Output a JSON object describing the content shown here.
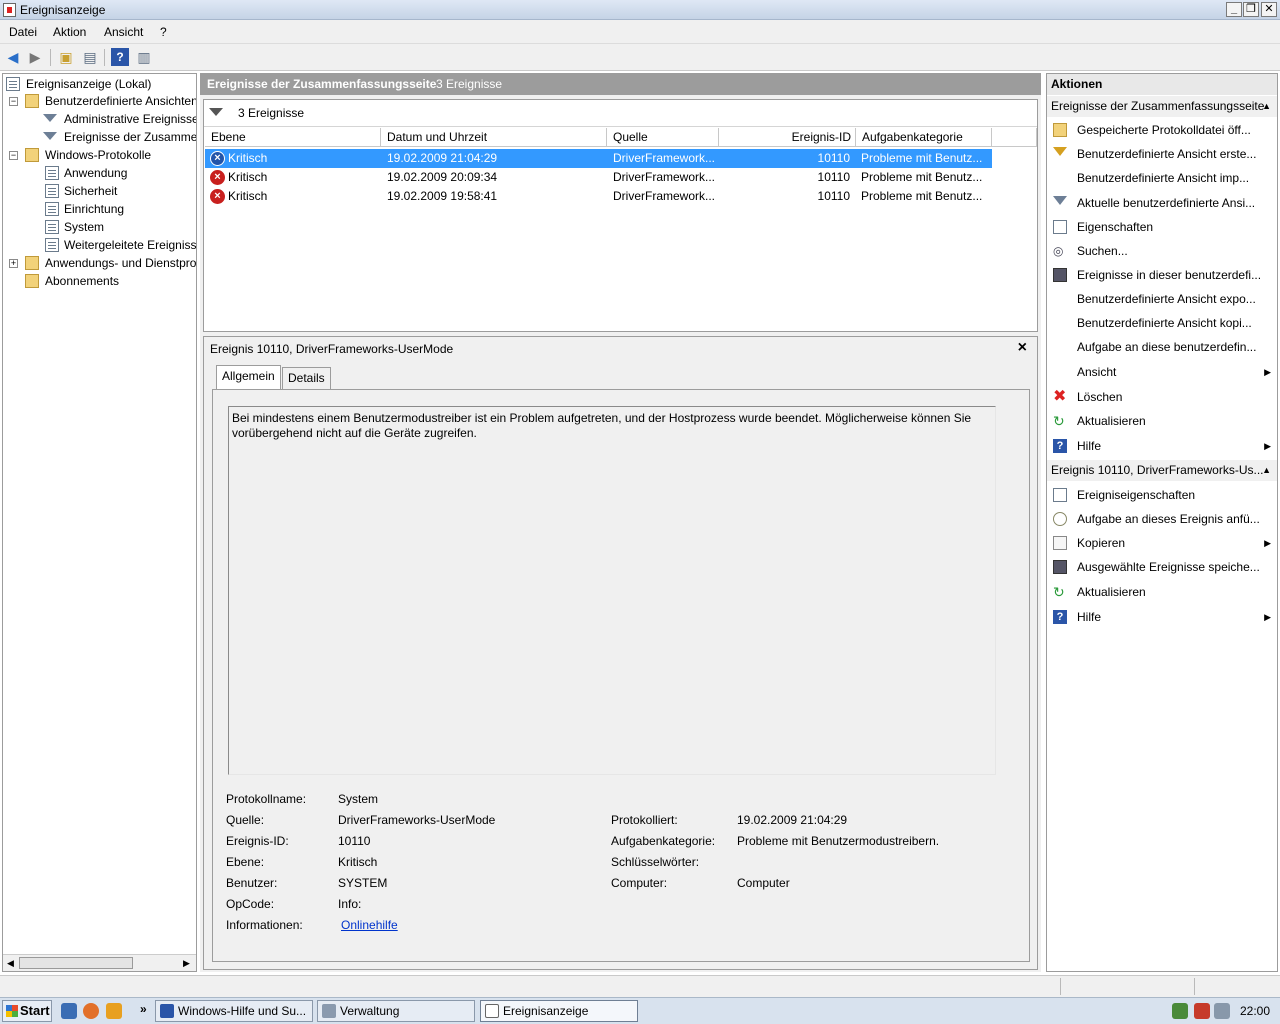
{
  "window": {
    "title": "Ereignisanzeige"
  },
  "menu": [
    "Datei",
    "Aktion",
    "Ansicht",
    "?"
  ],
  "tree": {
    "root": "Ereignisanzeige (Lokal)",
    "custom_views": "Benutzerdefinierte Ansichten",
    "admin_events": "Administrative Ereignisse",
    "summary_events": "Ereignisse der Zusammenfassungsseite",
    "windows_logs": "Windows-Protokolle",
    "application": "Anwendung",
    "security": "Sicherheit",
    "setup": "Einrichtung",
    "system": "System",
    "forwarded": "Weitergeleitete Ereignisse",
    "app_services": "Anwendungs- und Dienstprotokolle",
    "subscriptions": "Abonnements"
  },
  "center": {
    "header_title": "Ereignisse der Zusammenfassungsseite",
    "header_count": "3 Ereignisse",
    "filter_count": "3 Ereignisse",
    "columns": [
      "Ebene",
      "Datum und Uhrzeit",
      "Quelle",
      "Ereignis-ID",
      "Aufgabenkategorie"
    ],
    "rows": [
      {
        "level": "Kritisch",
        "datetime": "19.02.2009 21:04:29",
        "source": "DriverFramework...",
        "id": "10110",
        "category": "Probleme mit Benutz..."
      },
      {
        "level": "Kritisch",
        "datetime": "19.02.2009 20:09:34",
        "source": "DriverFramework...",
        "id": "10110",
        "category": "Probleme mit Benutz..."
      },
      {
        "level": "Kritisch",
        "datetime": "19.02.2009 19:58:41",
        "source": "DriverFramework...",
        "id": "10110",
        "category": "Probleme mit Benutz..."
      }
    ]
  },
  "detail": {
    "title": "Ereignis 10110, DriverFrameworks-UserMode",
    "tab_general": "Allgemein",
    "tab_details": "Details",
    "description": "Bei mindestens einem Benutzermodustreiber ist ein Problem aufgetreten, und der Hostprozess wurde beendet. Möglicherweise können Sie vorübergehend nicht auf die Geräte zugreifen.",
    "labels": {
      "log_name": "Protokollname:",
      "source": "Quelle:",
      "event_id": "Ereignis-ID:",
      "level": "Ebene:",
      "user": "Benutzer:",
      "opcode": "OpCode:",
      "info": "Informationen:",
      "logged": "Protokolliert:",
      "task_category": "Aufgabenkategorie:",
      "keywords": "Schlüsselwörter:",
      "computer": "Computer:"
    },
    "values": {
      "log_name": "System",
      "source": "DriverFrameworks-UserMode",
      "event_id": "10110",
      "level": "Kritisch",
      "user": "SYSTEM",
      "opcode": "Info:",
      "info_link": "Onlinehilfe",
      "logged": "19.02.2009 21:04:29",
      "task_category": "Probleme mit Benutzermodustreibern.",
      "keywords": "",
      "computer": "Computer"
    }
  },
  "actions": {
    "header": "Aktionen",
    "section1": "Ereignisse der Zusammenfassungsseite",
    "items1": [
      "Gespeicherte Protokolldatei öff...",
      "Benutzerdefinierte Ansicht erste...",
      "Benutzerdefinierte Ansicht imp...",
      "Aktuelle benutzerdefinierte Ansi...",
      "Eigenschaften",
      "Suchen...",
      "Ereignisse in dieser benutzerdefi...",
      "Benutzerdefinierte Ansicht expo...",
      "Benutzerdefinierte Ansicht kopi...",
      "Aufgabe an diese benutzerdefin...",
      "Ansicht",
      "Löschen",
      "Aktualisieren",
      "Hilfe"
    ],
    "section2": "Ereignis 10110, DriverFrameworks-Us...",
    "items2": [
      "Ereigniseigenschaften",
      "Aufgabe an dieses Ereignis anfü...",
      "Kopieren",
      "Ausgewählte Ereignisse speiche...",
      "Aktualisieren",
      "Hilfe"
    ]
  },
  "taskbar": {
    "start": "Start",
    "tasks": [
      "Windows-Hilfe und Su...",
      "Verwaltung",
      "Ereignisanzeige"
    ],
    "clock": "22:00"
  }
}
